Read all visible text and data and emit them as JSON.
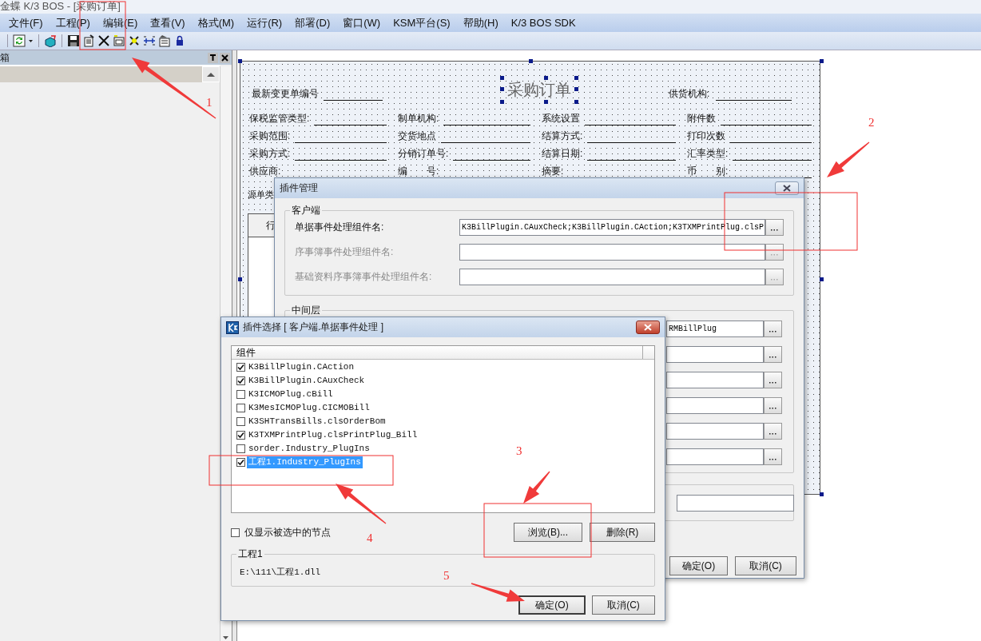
{
  "window": {
    "title": "金蝶 K/3 BOS - [采购订单]"
  },
  "menu": [
    "文件(F)",
    "工程(P)",
    "编辑(E)",
    "查看(V)",
    "格式(M)",
    "运行(R)",
    "部署(D)",
    "窗口(W)",
    "KSM平台(S)",
    "帮助(H)",
    "K/3 BOS SDK"
  ],
  "toolbox": {
    "title": "箱"
  },
  "form": {
    "title": "采购订单",
    "header_left": "最新变更单编号",
    "header_right": "供货机构:",
    "rows": [
      [
        "保税监管类型:",
        "制单机构:",
        "系统设置",
        "附件数"
      ],
      [
        "采购范围:",
        "交货地点",
        "结算方式:",
        "打印次数"
      ],
      [
        "采购方式:",
        "分销订单号:",
        "结算日期:",
        "汇率类型:"
      ],
      [
        "供应商:",
        "编　　号:",
        "摘要:",
        "币　　别:"
      ]
    ],
    "source_label": "源单类",
    "table_first_column": "行"
  },
  "plugin_manager": {
    "title": "插件管理",
    "client_group": "客户端",
    "client_rows": [
      {
        "label": "单据事件处理组件名:",
        "value": "K3BillPlugin.CAuxCheck;K3BillPlugin.CAction;K3TXMPrintPlug.clsP",
        "disabled": false
      },
      {
        "label": "序事簿事件处理组件名:",
        "disabled": true
      },
      {
        "label": "基础资料序事簿事件处理组件名:",
        "disabled": true
      }
    ],
    "middle_group": "中间层",
    "middle_fields": [
      {
        "kind": "filled",
        "value": "RMBillPlug"
      },
      {
        "kind": "empty"
      },
      {
        "kind": "empty"
      },
      {
        "kind": "empty"
      },
      {
        "kind": "empty"
      },
      {
        "kind": "empty"
      }
    ],
    "ok": "确定(O)",
    "cancel": "取消(C)"
  },
  "plugin_select": {
    "title": "插件选择 [ 客户端.单据事件处理 ]",
    "column": "组件",
    "items": [
      {
        "label": "K3BillPlugin.CAction",
        "checked": true,
        "selected": false
      },
      {
        "label": "K3BillPlugin.CAuxCheck",
        "checked": true,
        "selected": false
      },
      {
        "label": "K3ICMOPlug.cBill",
        "checked": false,
        "selected": false
      },
      {
        "label": "K3MesICMOPlug.CICMOBill",
        "checked": false,
        "selected": false
      },
      {
        "label": "K3SHTransBills.clsOrderBom",
        "checked": false,
        "selected": false
      },
      {
        "label": "K3TXMPrintPlug.clsPrintPlug_Bill",
        "checked": true,
        "selected": false
      },
      {
        "label": "sorder.Industry_PlugIns",
        "checked": false,
        "selected": false
      },
      {
        "label": "工程1.Industry_PlugIns",
        "checked": true,
        "selected": true
      }
    ],
    "show_selected_only": {
      "label": "仅显示被选中的节点",
      "checked": false
    },
    "browse": "浏览(B)...",
    "delete": "删除(R)",
    "detail_group": "工程1",
    "detail_path": "E:\\111\\工程1.dll",
    "ok": "确定(O)",
    "cancel": "取消(C)"
  },
  "annotations": [
    "1",
    "2",
    "3",
    "4",
    "5"
  ]
}
